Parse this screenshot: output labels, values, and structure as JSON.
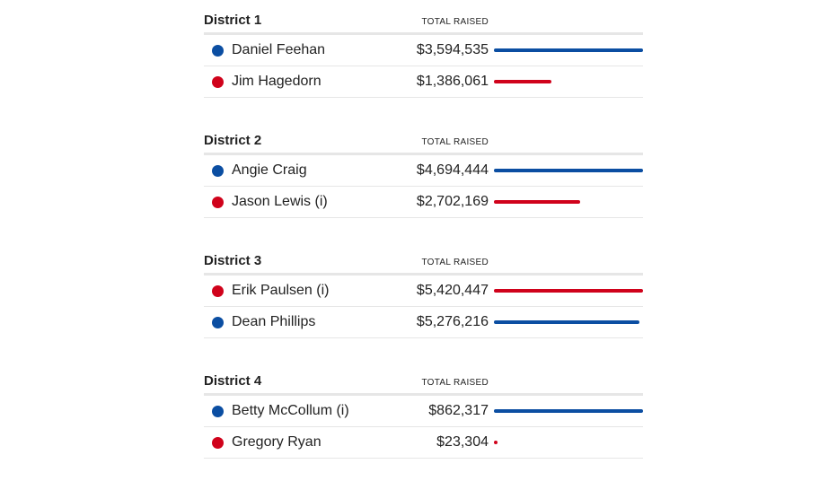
{
  "column_header": "TOTAL RAISED",
  "colors": {
    "dem": "#0b4ea2",
    "rep": "#d0021b"
  },
  "chart_data": {
    "type": "bar",
    "districts": [
      {
        "title": "District 1",
        "candidates": [
          {
            "name": "Daniel Feehan",
            "party": "dem",
            "amount": "$3,594,535",
            "value": 3594535
          },
          {
            "name": "Jim Hagedorn",
            "party": "rep",
            "amount": "$1,386,061",
            "value": 1386061
          }
        ]
      },
      {
        "title": "District 2",
        "candidates": [
          {
            "name": "Angie Craig",
            "party": "dem",
            "amount": "$4,694,444",
            "value": 4694444
          },
          {
            "name": "Jason Lewis (i)",
            "party": "rep",
            "amount": "$2,702,169",
            "value": 2702169
          }
        ]
      },
      {
        "title": "District 3",
        "candidates": [
          {
            "name": "Erik Paulsen (i)",
            "party": "rep",
            "amount": "$5,420,447",
            "value": 5420447
          },
          {
            "name": "Dean Phillips",
            "party": "dem",
            "amount": "$5,276,216",
            "value": 5276216
          }
        ]
      },
      {
        "title": "District 4",
        "candidates": [
          {
            "name": "Betty McCollum (i)",
            "party": "dem",
            "amount": "$862,317",
            "value": 862317
          },
          {
            "name": "Gregory Ryan",
            "party": "rep",
            "amount": "$23,304",
            "value": 23304
          }
        ]
      }
    ]
  }
}
